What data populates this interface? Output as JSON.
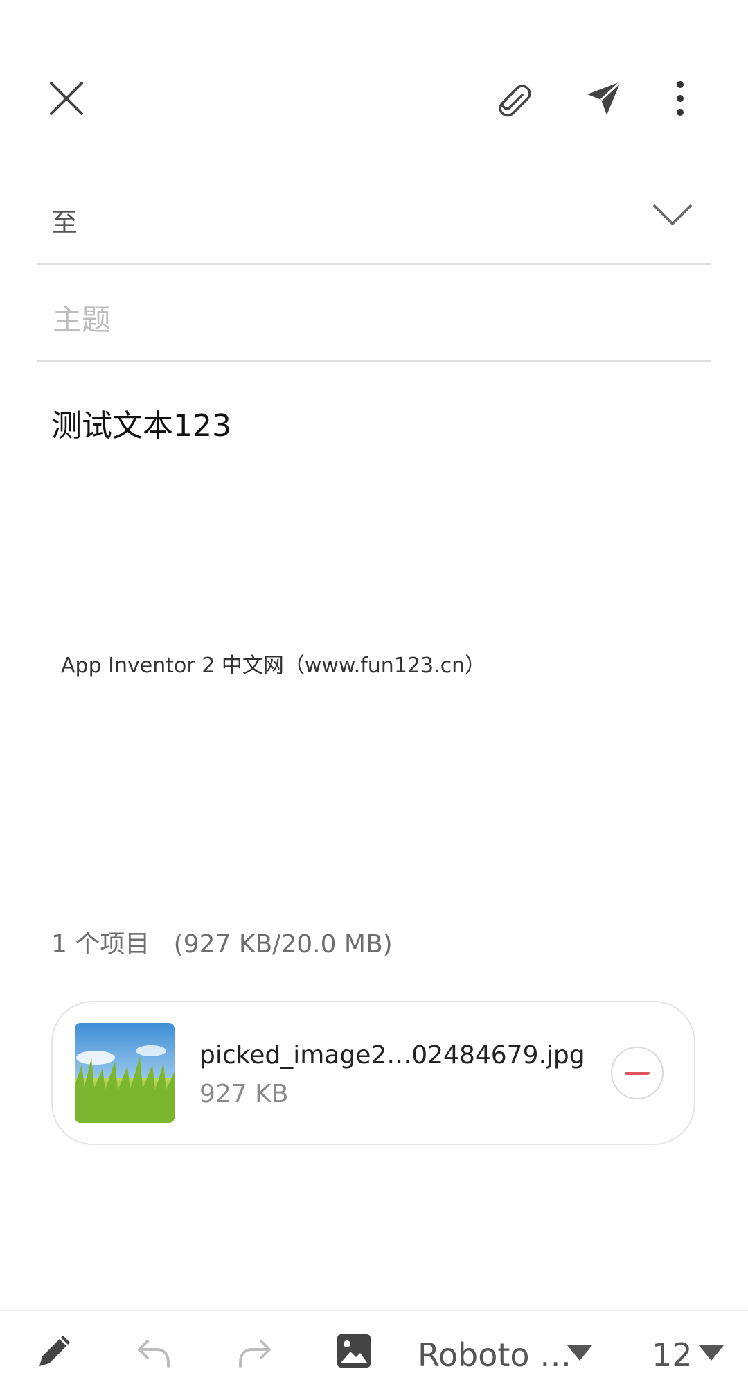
{
  "toolbar": {
    "close_icon": "close-icon",
    "attach_icon": "paperclip-icon",
    "send_icon": "send-icon",
    "more_icon": "more-vertical-icon"
  },
  "compose": {
    "to_label": "至",
    "subject_placeholder": "主题",
    "body_text": "测试文本123",
    "signature": "App Inventor 2 中文网（www.fun123.cn）"
  },
  "attachments": {
    "summary": "1 个项目   (927 KB/20.0 MB)",
    "items": [
      {
        "name": "picked_image2…02484679.jpg",
        "size": "927 KB"
      }
    ]
  },
  "editor_bar": {
    "font_name": "Roboto …",
    "font_size": "12"
  },
  "colors": {
    "remove_accent": "#e0555a",
    "icon_gray": "#444444"
  }
}
